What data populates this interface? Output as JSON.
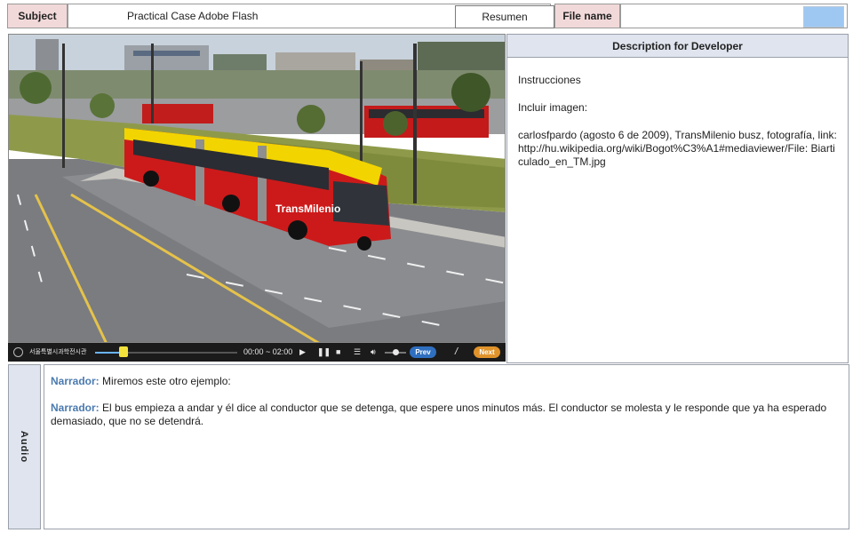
{
  "header": {
    "subject_label": "Subject",
    "subject_value": "Practical Case Adobe Flash",
    "summary_button": "Resumen",
    "file_name_label": "File name",
    "file_name_value": ""
  },
  "player": {
    "brand": "서울특별시과학전시관",
    "progress": 0.2,
    "time": "00:00 ~ 02:00",
    "play_icon": "play-icon",
    "pause_icon": "pause-icon",
    "stop_icon": "stop-icon",
    "menu_icon": "menu-icon",
    "volume_icon": "volume-icon",
    "volume_level": 0.5,
    "prev_label": "Prev",
    "page_separator": "/",
    "next_label": "Next"
  },
  "description": {
    "title": "Description for Developer",
    "lines": [
      "Instrucciones",
      "Incluir imagen:",
      "carlosfpardo (agosto 6 de 2009), TransMilenio busz, fotografía, link: http://hu.wikipedia.org/wiki/Bogot%C3%A1#mediaviewer/File: Biarticulado_en_TM.jpg"
    ]
  },
  "audio": {
    "tab_label": "Audio",
    "entries": [
      {
        "speaker": "Narrador:",
        "text": "Miremos este otro ejemplo:"
      },
      {
        "speaker": "Narrador:",
        "text": "El bus empieza a andar y él dice al conductor que se detenga, que espere unos minutos más. El conductor se molesta y le responde que ya ha esperado demasiado, que no se detendrá."
      }
    ]
  },
  "photo": {
    "bus_text": "TransMilenio",
    "colors": {
      "bus_red": "#cc1a1a",
      "bus_yellow": "#f2d400",
      "road": "#7a7c80",
      "grass": "#8e9a4a"
    }
  }
}
